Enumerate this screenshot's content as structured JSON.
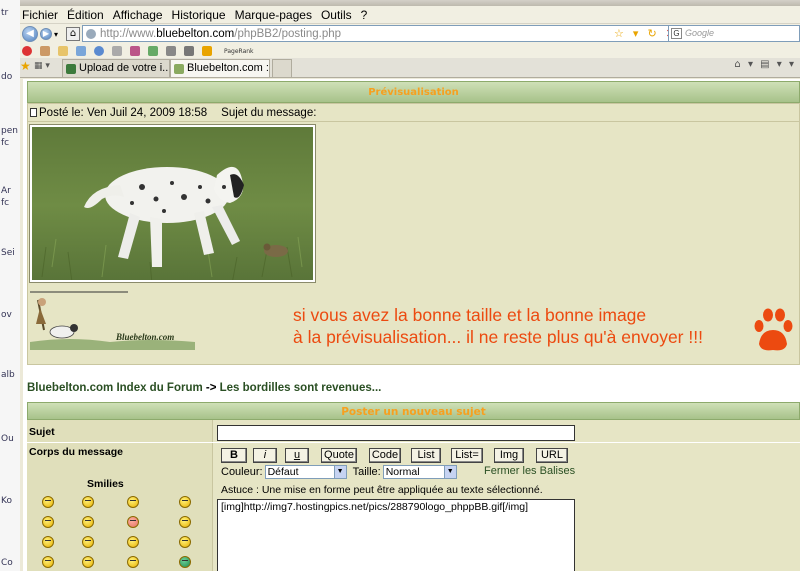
{
  "menu": [
    "Fichier",
    "Édition",
    "Affichage",
    "Historique",
    "Marque-pages",
    "Outils",
    "?"
  ],
  "url": {
    "prefix": "http://www.",
    "host": "bluebelton.com",
    "path": "/phpBB2/posting.php"
  },
  "search": {
    "placeholder": "Google"
  },
  "toolbar": {
    "pagerank": "PageRank"
  },
  "tabs": [
    {
      "label": "Upload de votre i..."
    },
    {
      "label": "Bluebelton.com :: ..."
    }
  ],
  "preview": {
    "header": "Prévisualisation",
    "posted_label": "Posté le: Ven Juil 24, 2009 18:58",
    "subject_label": "Sujet du message:",
    "logo_text": "Bluebelton.com",
    "message_line1": "si vous avez la bonne taille et la bonne image",
    "message_line2": "à la prévisualisation... il ne reste plus qu'à envoyer !!!"
  },
  "breadcrumb": {
    "index": "Bluebelton.com Index du Forum",
    "sep": " -> ",
    "topic": "Les bordilles sont revenues..."
  },
  "post_form": {
    "header": "Poster un nouveau sujet",
    "subject_label": "Sujet",
    "body_label": "Corps du message",
    "smilies_label": "Smilies",
    "buttons": [
      "B",
      "i",
      "u",
      "Quote",
      "Code",
      "List",
      "List=",
      "Img",
      "URL"
    ],
    "color_label": "Couleur:",
    "color_value": "Défaut",
    "size_label": "Taille:",
    "size_value": "Normal",
    "close_tags": "Fermer les Balises",
    "tip": "Astuce : Une mise en forme peut être appliquée au texte sélectionné.",
    "textarea": "[img]http://img7.hostingpics.net/pics/288790logo_phppBB.gif[/img]"
  },
  "colors": {
    "accent_orange": "#ec4a10",
    "header_green": "#a7c28a",
    "body_beige": "#e6e5c5"
  }
}
